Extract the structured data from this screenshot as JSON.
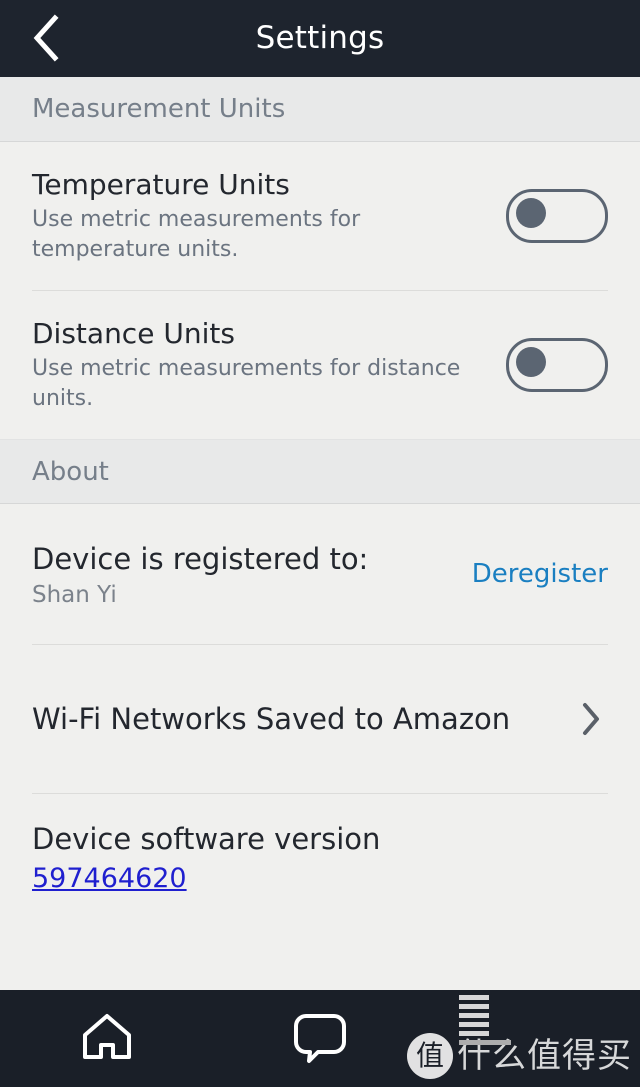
{
  "header": {
    "title": "Settings",
    "back_icon": "chevron-left-icon"
  },
  "sections": [
    {
      "id": "measurement-units",
      "title": "Measurement Units",
      "rows": [
        {
          "id": "temperature-units",
          "title": "Temperature Units",
          "subtitle": "Use metric measurements for temperature units.",
          "control": "toggle",
          "state": "off"
        },
        {
          "id": "distance-units",
          "title": "Distance Units",
          "subtitle": "Use metric measurements for distance units.",
          "control": "toggle",
          "state": "off"
        }
      ]
    },
    {
      "id": "about",
      "title": "About",
      "rows": [
        {
          "id": "device-registered",
          "title": "Device is registered to:",
          "subtitle": "Shan Yi",
          "control": "link",
          "action_label": "Deregister"
        },
        {
          "id": "wifi-networks",
          "title": "Wi-Fi Networks Saved to Amazon",
          "control": "chevron",
          "chevron_icon": "chevron-right-icon"
        },
        {
          "id": "device-software-version",
          "title": "Device software version",
          "link_value": "597464620",
          "control": "link-value"
        }
      ]
    }
  ],
  "bottom_nav": {
    "items": [
      {
        "id": "home",
        "icon": "home-icon"
      },
      {
        "id": "messages",
        "icon": "chat-bubble-icon"
      }
    ],
    "watermark": {
      "badge": "值",
      "text": "什么值得买",
      "bars_icon": "bar-chart-icon"
    }
  },
  "colors": {
    "header_bg": "#1e242e",
    "nav_bg": "#1a1f28",
    "page_bg": "#f0f0ee",
    "band_bg": "#e8e9e9",
    "title_text": "#23272e",
    "subtitle_text": "#6b7480",
    "section_text": "#767f8a",
    "accent_link": "#1a7fc1",
    "version_link": "#1f1fcf",
    "toggle_stroke": "#5b6572",
    "divider": "#dcdcda"
  }
}
